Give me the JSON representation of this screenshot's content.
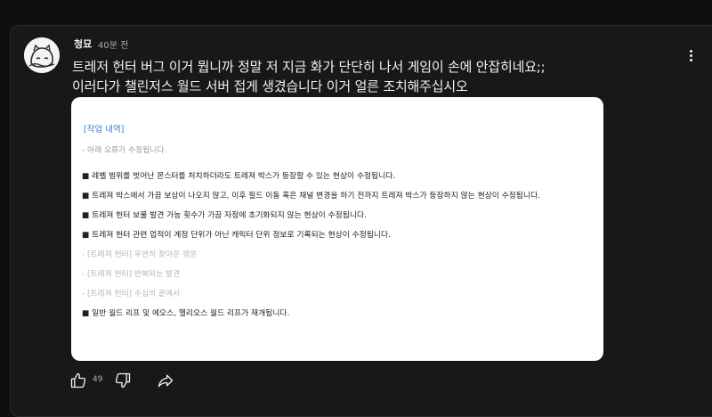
{
  "comment": {
    "author": "청묘",
    "time": "40분 전",
    "text_lines": [
      "트레저 헌터 버그 이거 뭡니까 정말 저 지금 화가 단단히 나서 게임이 손에 안잡히네요;;",
      "이러다가 챌린저스 월드 서버 접게 생겼습니다 이거 얼른 조치해주십시오"
    ],
    "likes": "49"
  },
  "notice": {
    "header": "[작업 내역]",
    "items": [
      {
        "text": "- 아래 오류가 수정됩니다.",
        "style": "gray"
      },
      {
        "text": "■ 레벨 범위를 벗어난 몬스터를 처치하더라도 트레져 박스가 등장할 수 있는 현상이 수정됩니다.",
        "style": "bullet"
      },
      {
        "text": "■ 트레져 박스에서 가끔 보상이 나오지 않고, 이후 필드 이동 혹은 채널 변경을 하기 전까지 트레져 박스가 등장하지 않는 현상이 수정됩니다.",
        "style": "bullet"
      },
      {
        "text": "■ 트레져 헌터 보물 발견 가능 횟수가 가끔 자정에 초기화되지 않는 현상이 수정됩니다.",
        "style": "bullet"
      },
      {
        "text": "■ 트레져 헌터 관련 업적이 계정 단위가 아닌 캐릭터 단위 정보로 기록되는 현상이 수정됩니다.",
        "style": "bullet"
      },
      {
        "text": "- [트레져 헌터] 우연히 찾아온 행운",
        "style": "light"
      },
      {
        "text": "- [트레져 헌터] 반복되는 발견",
        "style": "light"
      },
      {
        "text": "- [트레져 헌터] 수십의 끝에서",
        "style": "light"
      },
      {
        "text": "■ 일반 월드 리프 및 에오스, 헬리오스 월드 리프가 재개됩니다.",
        "style": "bullet"
      }
    ]
  },
  "icons": {
    "more": "more-vert-icon",
    "like": "thumb-up-icon",
    "dislike": "thumb-down-icon",
    "share": "share-icon"
  },
  "colors": {
    "background": "#0f0f0f",
    "panel": "#181818",
    "text": "#f1f1f1",
    "muted": "#aaaaaa",
    "notice_header": "#3a7bd5"
  }
}
